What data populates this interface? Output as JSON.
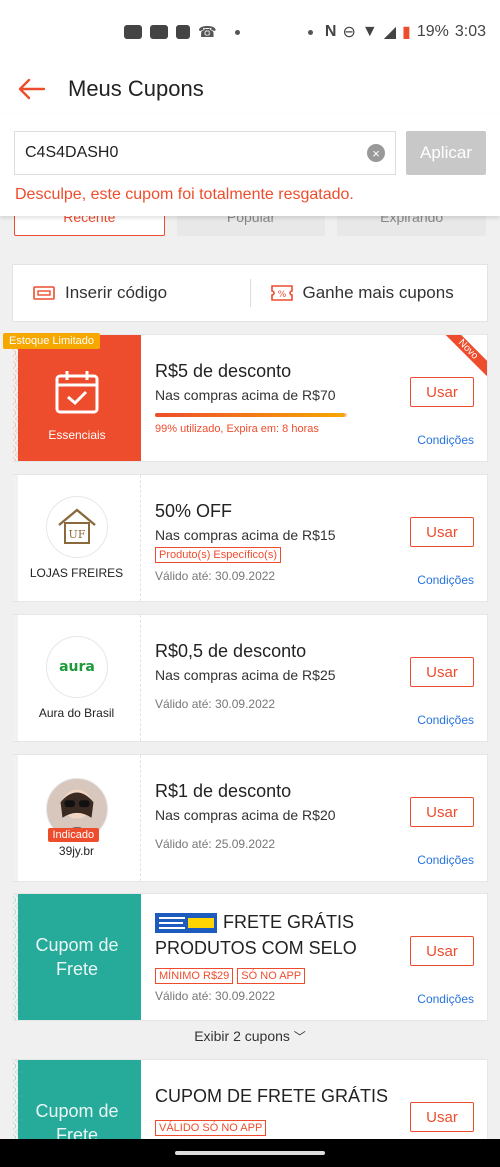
{
  "status_bar": {
    "battery": "19%",
    "time": "3:03"
  },
  "header": {
    "title": "Meus Cupons"
  },
  "code_entry": {
    "value": "C4S4DASH0",
    "apply_label": "Aplicar",
    "error": "Desculpe, este cupom foi totalmente resgatado."
  },
  "tabs": [
    "Recente",
    "Popular",
    "Expirando"
  ],
  "actions": {
    "insert_code": "Inserir código",
    "earn_more": "Ganhe mais cupons"
  },
  "coupons": [
    {
      "badge": "Estoque Limitado",
      "ribbon": "Novo",
      "left_label": "Essenciais",
      "title": "R$5 de desconto",
      "subtitle": "Nas compras acima de R$70",
      "used_percent": 99,
      "status": "99% utilizado, Expira em: 8 horas",
      "use_label": "Usar",
      "conditions_label": "Condições"
    },
    {
      "shop": "LOJAS FREIRES",
      "title": "50% OFF",
      "subtitle": "Nas compras acima de R$15",
      "tag": "Produto(s) Específico(s)",
      "valid": "Válido até: 30.09.2022",
      "use_label": "Usar",
      "conditions_label": "Condições"
    },
    {
      "shop": "Aura do Brasil",
      "title": "R$0,5 de desconto",
      "subtitle": "Nas compras acima de R$25",
      "valid": "Válido até: 30.09.2022",
      "use_label": "Usar",
      "conditions_label": "Condições"
    },
    {
      "shop": "39jy.br",
      "shop_badge": "Indicado",
      "title": "R$1 de desconto",
      "subtitle": "Nas compras acima de R$20",
      "valid": "Válido até: 25.09.2022",
      "use_label": "Usar",
      "conditions_label": "Condições"
    },
    {
      "left_label": "Cupom de Frete",
      "title_line1": "FRETE GRÁTIS",
      "title_line2": "PRODUTOS COM SELO",
      "tags": [
        "MÍNIMO R$29",
        "SÓ NO APP"
      ],
      "valid": "Válido até: 30.09.2022",
      "use_label": "Usar",
      "conditions_label": "Condições"
    },
    {
      "left_label": "Cupom de Frete",
      "title": "CUPOM DE FRETE GRÁTIS",
      "tag": "VÁLIDO SÓ NO APP",
      "use_label": "Usar"
    }
  ],
  "show_more": "Exibir 2 cupons",
  "colors": {
    "accent": "#ee4d2d",
    "teal": "#26aa99",
    "link": "#2673dd"
  }
}
